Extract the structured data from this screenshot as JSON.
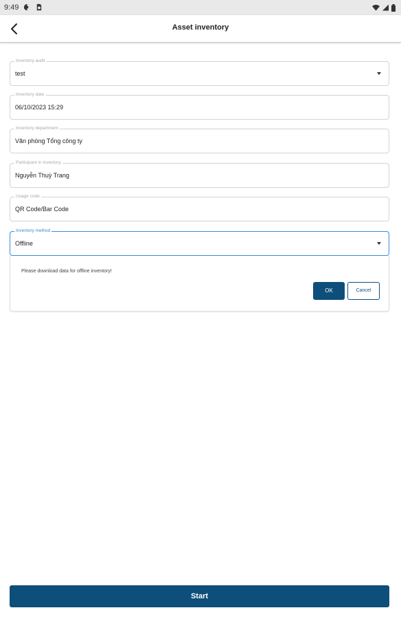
{
  "status_bar": {
    "time": "9:49",
    "left_icons": [
      "sync-status-icon",
      "sim-card-icon"
    ],
    "right_icons": [
      "wifi-icon",
      "signal-icon",
      "battery-icon"
    ]
  },
  "header": {
    "back_icon": "arrow-left-icon",
    "title": "Asset inventory"
  },
  "form": {
    "inventory_audit": {
      "label": "Inventory audit",
      "value": "test"
    },
    "inventory_date": {
      "label": "Inventory date",
      "value": "06/10/2023 15:29"
    },
    "inventory_department": {
      "label": "Inventory department",
      "value": "Văn phòng Tổng công ty"
    },
    "participant": {
      "label": "Participant in inventory",
      "value": "Nguyễn Thuỳ Trang"
    },
    "usage_code": {
      "label": "Usage code",
      "value": "QR Code/Bar Code"
    },
    "inventory_method": {
      "label": "Inventory method",
      "value": "Offline"
    }
  },
  "dialog": {
    "message": "Please download data for offline inventory!",
    "ok_label": "OK",
    "cancel_label": "Cancel"
  },
  "actions": {
    "start_label": "Start"
  },
  "colors": {
    "primary": "#0d4f7a",
    "focus_outline": "#3a8bd8",
    "status_bar": "#e9e9e9",
    "field_border": "#d3d3d3"
  }
}
